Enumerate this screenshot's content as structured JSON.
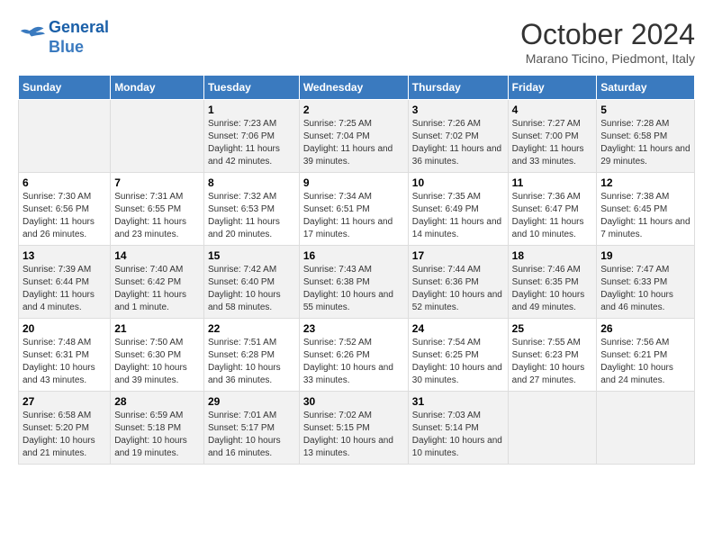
{
  "header": {
    "logo_line1": "General",
    "logo_line2": "Blue",
    "month_title": "October 2024",
    "location": "Marano Ticino, Piedmont, Italy"
  },
  "days_of_week": [
    "Sunday",
    "Monday",
    "Tuesday",
    "Wednesday",
    "Thursday",
    "Friday",
    "Saturday"
  ],
  "weeks": [
    [
      {
        "day": "",
        "info": ""
      },
      {
        "day": "",
        "info": ""
      },
      {
        "day": "1",
        "info": "Sunrise: 7:23 AM\nSunset: 7:06 PM\nDaylight: 11 hours and 42 minutes."
      },
      {
        "day": "2",
        "info": "Sunrise: 7:25 AM\nSunset: 7:04 PM\nDaylight: 11 hours and 39 minutes."
      },
      {
        "day": "3",
        "info": "Sunrise: 7:26 AM\nSunset: 7:02 PM\nDaylight: 11 hours and 36 minutes."
      },
      {
        "day": "4",
        "info": "Sunrise: 7:27 AM\nSunset: 7:00 PM\nDaylight: 11 hours and 33 minutes."
      },
      {
        "day": "5",
        "info": "Sunrise: 7:28 AM\nSunset: 6:58 PM\nDaylight: 11 hours and 29 minutes."
      }
    ],
    [
      {
        "day": "6",
        "info": "Sunrise: 7:30 AM\nSunset: 6:56 PM\nDaylight: 11 hours and 26 minutes."
      },
      {
        "day": "7",
        "info": "Sunrise: 7:31 AM\nSunset: 6:55 PM\nDaylight: 11 hours and 23 minutes."
      },
      {
        "day": "8",
        "info": "Sunrise: 7:32 AM\nSunset: 6:53 PM\nDaylight: 11 hours and 20 minutes."
      },
      {
        "day": "9",
        "info": "Sunrise: 7:34 AM\nSunset: 6:51 PM\nDaylight: 11 hours and 17 minutes."
      },
      {
        "day": "10",
        "info": "Sunrise: 7:35 AM\nSunset: 6:49 PM\nDaylight: 11 hours and 14 minutes."
      },
      {
        "day": "11",
        "info": "Sunrise: 7:36 AM\nSunset: 6:47 PM\nDaylight: 11 hours and 10 minutes."
      },
      {
        "day": "12",
        "info": "Sunrise: 7:38 AM\nSunset: 6:45 PM\nDaylight: 11 hours and 7 minutes."
      }
    ],
    [
      {
        "day": "13",
        "info": "Sunrise: 7:39 AM\nSunset: 6:44 PM\nDaylight: 11 hours and 4 minutes."
      },
      {
        "day": "14",
        "info": "Sunrise: 7:40 AM\nSunset: 6:42 PM\nDaylight: 11 hours and 1 minute."
      },
      {
        "day": "15",
        "info": "Sunrise: 7:42 AM\nSunset: 6:40 PM\nDaylight: 10 hours and 58 minutes."
      },
      {
        "day": "16",
        "info": "Sunrise: 7:43 AM\nSunset: 6:38 PM\nDaylight: 10 hours and 55 minutes."
      },
      {
        "day": "17",
        "info": "Sunrise: 7:44 AM\nSunset: 6:36 PM\nDaylight: 10 hours and 52 minutes."
      },
      {
        "day": "18",
        "info": "Sunrise: 7:46 AM\nSunset: 6:35 PM\nDaylight: 10 hours and 49 minutes."
      },
      {
        "day": "19",
        "info": "Sunrise: 7:47 AM\nSunset: 6:33 PM\nDaylight: 10 hours and 46 minutes."
      }
    ],
    [
      {
        "day": "20",
        "info": "Sunrise: 7:48 AM\nSunset: 6:31 PM\nDaylight: 10 hours and 43 minutes."
      },
      {
        "day": "21",
        "info": "Sunrise: 7:50 AM\nSunset: 6:30 PM\nDaylight: 10 hours and 39 minutes."
      },
      {
        "day": "22",
        "info": "Sunrise: 7:51 AM\nSunset: 6:28 PM\nDaylight: 10 hours and 36 minutes."
      },
      {
        "day": "23",
        "info": "Sunrise: 7:52 AM\nSunset: 6:26 PM\nDaylight: 10 hours and 33 minutes."
      },
      {
        "day": "24",
        "info": "Sunrise: 7:54 AM\nSunset: 6:25 PM\nDaylight: 10 hours and 30 minutes."
      },
      {
        "day": "25",
        "info": "Sunrise: 7:55 AM\nSunset: 6:23 PM\nDaylight: 10 hours and 27 minutes."
      },
      {
        "day": "26",
        "info": "Sunrise: 7:56 AM\nSunset: 6:21 PM\nDaylight: 10 hours and 24 minutes."
      }
    ],
    [
      {
        "day": "27",
        "info": "Sunrise: 6:58 AM\nSunset: 5:20 PM\nDaylight: 10 hours and 21 minutes."
      },
      {
        "day": "28",
        "info": "Sunrise: 6:59 AM\nSunset: 5:18 PM\nDaylight: 10 hours and 19 minutes."
      },
      {
        "day": "29",
        "info": "Sunrise: 7:01 AM\nSunset: 5:17 PM\nDaylight: 10 hours and 16 minutes."
      },
      {
        "day": "30",
        "info": "Sunrise: 7:02 AM\nSunset: 5:15 PM\nDaylight: 10 hours and 13 minutes."
      },
      {
        "day": "31",
        "info": "Sunrise: 7:03 AM\nSunset: 5:14 PM\nDaylight: 10 hours and 10 minutes."
      },
      {
        "day": "",
        "info": ""
      },
      {
        "day": "",
        "info": ""
      }
    ]
  ]
}
